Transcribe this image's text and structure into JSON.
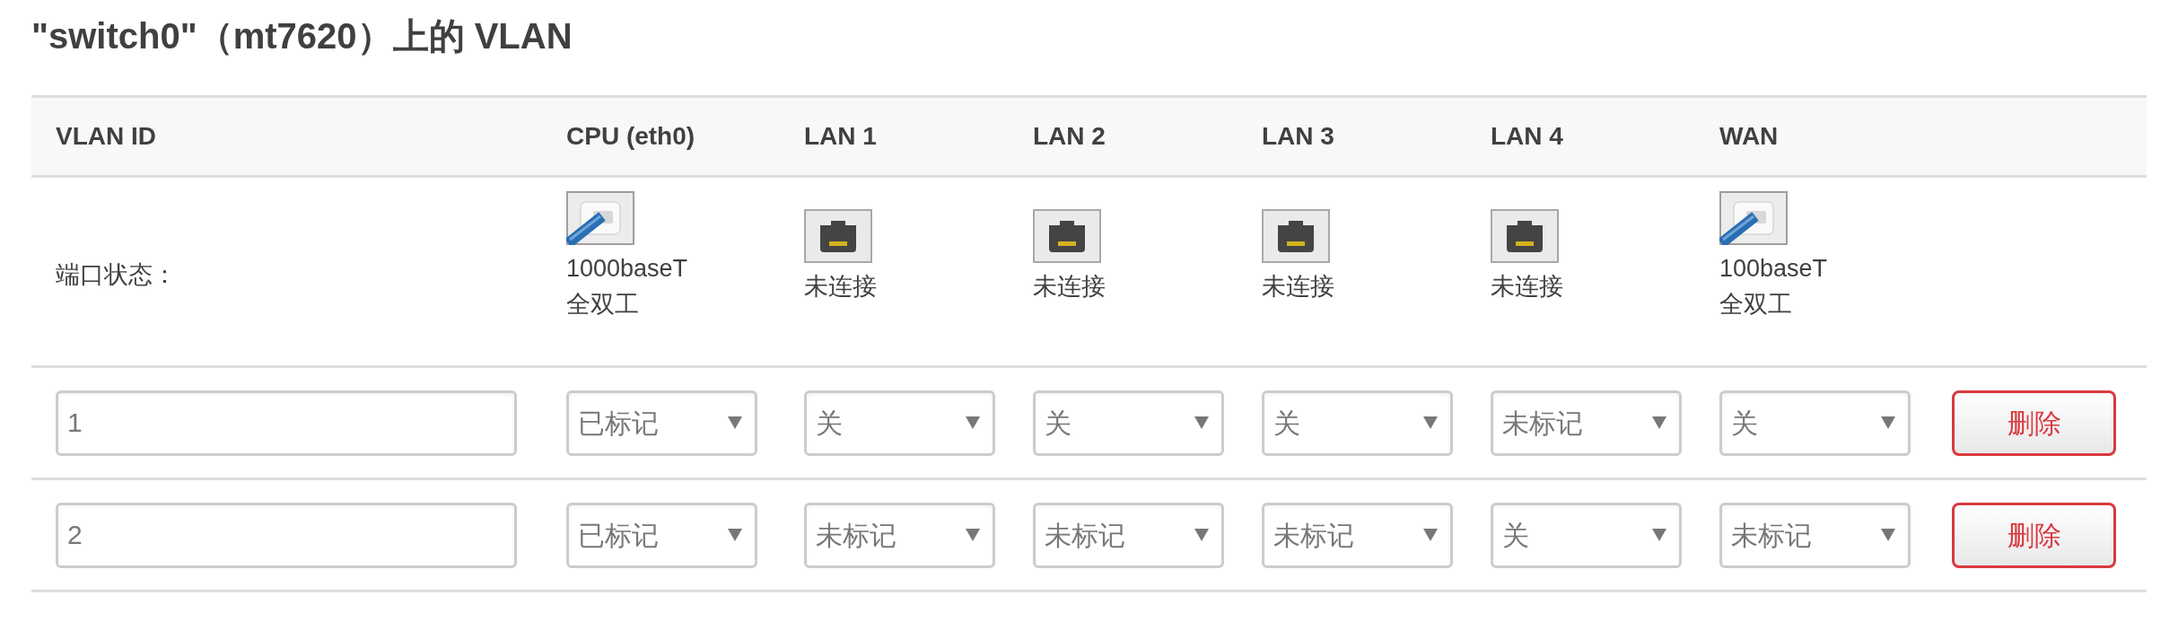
{
  "title": "\"switch0\"（mt7620）上的 VLAN",
  "table": {
    "columns": [
      "VLAN ID",
      "CPU (eth0)",
      "LAN 1",
      "LAN 2",
      "LAN 3",
      "LAN 4",
      "WAN"
    ],
    "status_row": {
      "label": "端口状态：",
      "ports": [
        {
          "kind": "connected",
          "lines": [
            "1000baseT",
            "全双工"
          ]
        },
        {
          "kind": "disconnected",
          "lines": [
            "未连接"
          ]
        },
        {
          "kind": "disconnected",
          "lines": [
            "未连接"
          ]
        },
        {
          "kind": "disconnected",
          "lines": [
            "未连接"
          ]
        },
        {
          "kind": "disconnected",
          "lines": [
            "未连接"
          ]
        },
        {
          "kind": "connected",
          "lines": [
            "100baseT",
            "全双工"
          ]
        }
      ]
    },
    "rows": [
      {
        "vlan_id": "1",
        "ports": [
          "已标记",
          "关",
          "关",
          "关",
          "未标记",
          "关"
        ],
        "delete_button": "删除"
      },
      {
        "vlan_id": "2",
        "ports": [
          "已标记",
          "未标记",
          "未标记",
          "未标记",
          "关",
          "未标记"
        ],
        "delete_button": "删除"
      }
    ]
  }
}
